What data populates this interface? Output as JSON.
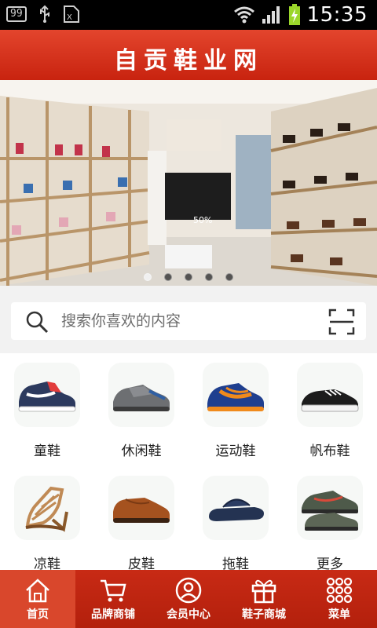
{
  "status_bar": {
    "badge": "99",
    "time": "15:35"
  },
  "app": {
    "title": "自贡鞋业网"
  },
  "banner": {
    "sale_tag": "50%",
    "slide_count": 5,
    "active_slide": 0
  },
  "search": {
    "placeholder": "搜索你喜欢的内容"
  },
  "categories": [
    {
      "label": "童鞋",
      "icon": "kids-sneaker"
    },
    {
      "label": "休闲鞋",
      "icon": "casual-shoe"
    },
    {
      "label": "运动鞋",
      "icon": "running-shoe"
    },
    {
      "label": "帆布鞋",
      "icon": "canvas-shoe"
    },
    {
      "label": "凉鞋",
      "icon": "sandal"
    },
    {
      "label": "皮鞋",
      "icon": "leather-shoe"
    },
    {
      "label": "拖鞋",
      "icon": "slipper"
    },
    {
      "label": "更多",
      "icon": "hiking-shoe"
    }
  ],
  "bottom_nav": [
    {
      "label": "首页",
      "icon": "home-icon",
      "active": true
    },
    {
      "label": "品牌商铺",
      "icon": "cart-icon",
      "active": false
    },
    {
      "label": "会员中心",
      "icon": "user-icon",
      "active": false
    },
    {
      "label": "鞋子商城",
      "icon": "gift-icon",
      "active": false
    },
    {
      "label": "菜单",
      "icon": "grid-icon",
      "active": false
    }
  ],
  "colors": {
    "brand_red": "#c8230f",
    "nav_active": "#d9472c"
  }
}
